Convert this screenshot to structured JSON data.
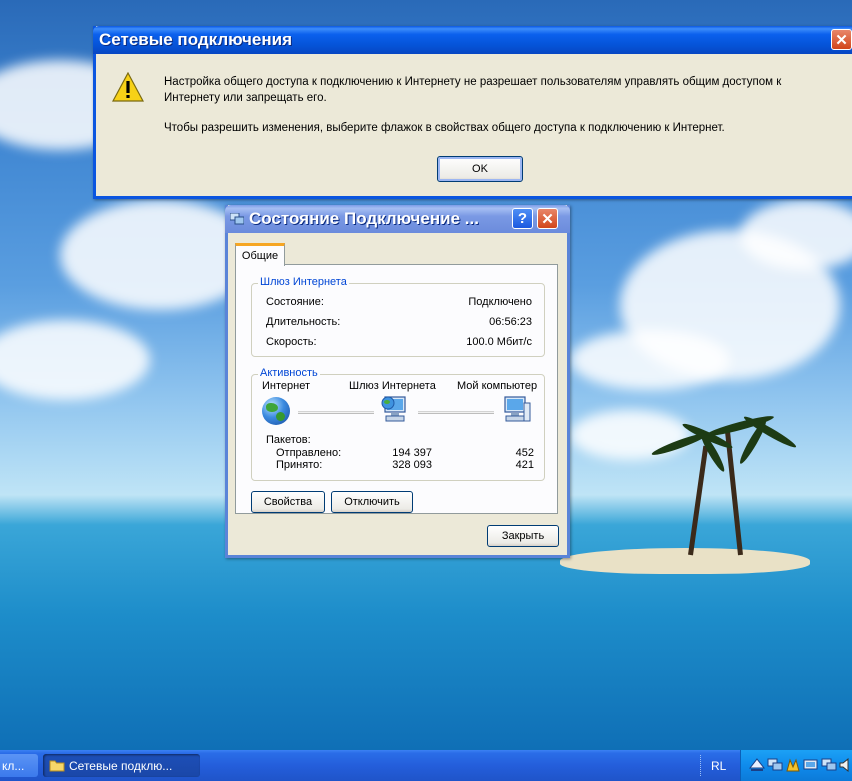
{
  "message_box": {
    "title": "Сетевые подключения",
    "line1": "Настройка общего доступа к подключению к Интернету не разрешает пользователям управлять общим доступом к",
    "line2": "Интернету или запрещать его.",
    "line3": "Чтобы разрешить изменения, выберите флажок в свойствах общего доступа к подключению к Интернет.",
    "ok_label": "OK",
    "close_glyph": "✕"
  },
  "status_window": {
    "title": "Состояние Подключение ...",
    "help_glyph": "?",
    "close_glyph": "✕",
    "tab_general": "Общие",
    "gateway_group": {
      "title": "Шлюз Интернета",
      "rows": [
        {
          "label": "Состояние:",
          "value": "Подключено"
        },
        {
          "label": "Длительность:",
          "value": "06:56:23"
        },
        {
          "label": "Скорость:",
          "value": "100.0 Мбит/с"
        }
      ]
    },
    "activity_group": {
      "title": "Активность",
      "node_internet": "Интернет",
      "node_gateway": "Шлюз Интернета",
      "node_my_computer": "Мой компьютер",
      "packets_label": "Пакетов:",
      "sent_label": "Отправлено:",
      "sent_gateway": "194 397",
      "sent_computer": "452",
      "received_label": "Принято:",
      "received_gateway": "328 093",
      "received_computer": "421"
    },
    "properties_button": "Свойства",
    "disconnect_button": "Отключить",
    "close_button": "Закрыть"
  },
  "taskbar": {
    "left_fragment": "кл...",
    "task_label": "Сетевые подклю...",
    "language": "RL"
  },
  "colors": {
    "taskbar_blue": "#245edb",
    "tray_blue": "#0f8bec",
    "title_blue": "#0a58e2",
    "window_bg": "#ece9d8",
    "group_title": "#0046d5"
  }
}
